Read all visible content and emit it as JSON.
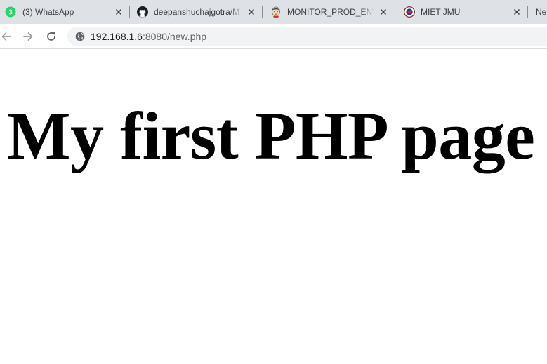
{
  "browser": {
    "tabs": [
      {
        "title": "(3) WhatsApp",
        "icon": "whatsapp-icon",
        "badge": "3",
        "close": "close-icon"
      },
      {
        "title": "deepanshuchajgotra/M",
        "icon": "github-icon",
        "close": "close-icon"
      },
      {
        "title": "MONITOR_PROD_ENVIR",
        "icon": "jenkins-icon",
        "close": "close-icon"
      },
      {
        "title": "MIET JMU",
        "icon": "miet-logo-icon",
        "close": "close-icon"
      },
      {
        "title": "Ne"
      }
    ],
    "toolbar": {
      "back_icon": "back-arrow-icon",
      "forward_icon": "forward-arrow-icon",
      "reload_icon": "reload-icon"
    },
    "address": {
      "host": "192.168.1.6",
      "rest": ":8080/new.php",
      "site_icon": "globe-icon"
    }
  },
  "page": {
    "heading": "My first PHP page"
  },
  "colors": {
    "tabstrip": "#dee1e6",
    "whatsapp": "#25d366",
    "omnibox": "#f1f3f4",
    "heading": "#000000"
  }
}
